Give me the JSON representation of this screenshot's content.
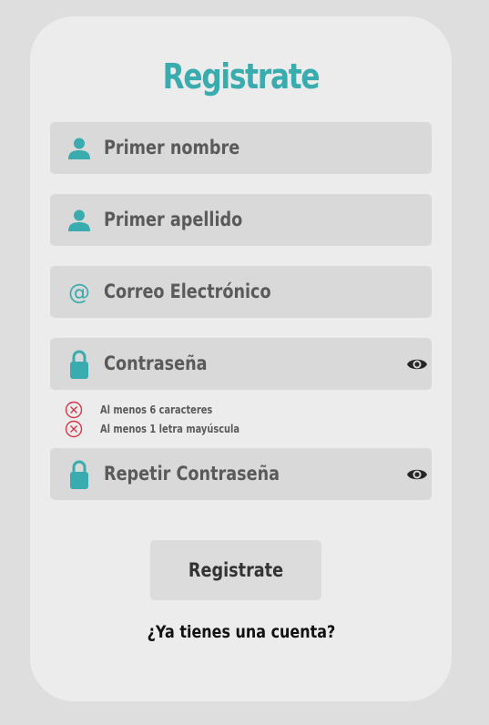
{
  "form": {
    "title": "Registrate",
    "fields": [
      {
        "label": "Primer nombre",
        "icon": "user-icon"
      },
      {
        "label": "Primer apellido",
        "icon": "user-icon"
      },
      {
        "label": "Correo Electrónico",
        "icon": "at-icon",
        "icon_glyph": "@"
      },
      {
        "label": "Contraseña",
        "icon": "lock-icon",
        "toggle_icon": "eye-icon"
      },
      {
        "label": "Repetir Contraseña",
        "icon": "lock-icon",
        "toggle_icon": "eye-icon"
      }
    ],
    "password_requirements": [
      {
        "text": "Al menos 6 caracteres",
        "status": "unmet",
        "icon": "x-circle-icon"
      },
      {
        "text": "Al menos 1 letra mayúscula",
        "status": "unmet",
        "icon": "x-circle-icon"
      }
    ],
    "submit_label": "Registrate",
    "login_prompt": "¿Ya tienes una cuenta?"
  },
  "colors": {
    "accent": "#3aabae",
    "error": "#d9364a",
    "page_background": "#dedede",
    "card_background": "#ececec",
    "field_background": "#d9d9d9"
  }
}
